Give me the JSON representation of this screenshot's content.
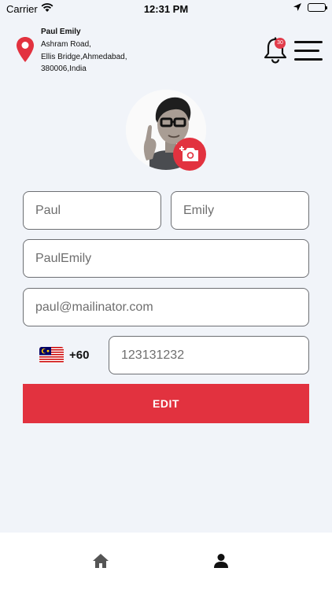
{
  "status_bar": {
    "carrier": "Carrier",
    "time": "12:31 PM"
  },
  "header": {
    "user_name": "Paul Emily",
    "address_lines": [
      "Ashram Road,",
      "Ellis Bridge,Ahmedabad,",
      "380006,India"
    ],
    "notification_count": "30",
    "icons": {
      "location": "location-pin-icon",
      "bell": "bell-icon",
      "menu": "hamburger-menu-icon"
    }
  },
  "profile": {
    "camera_icon": "camera-add-icon"
  },
  "form": {
    "first_name": "Paul",
    "last_name": "Emily",
    "username": "PaulEmily",
    "email": "paul@mailinator.com",
    "country_code": "+60",
    "phone": "123131232",
    "edit_label": "EDIT"
  },
  "tabbar": {
    "items": [
      {
        "icon": "home-icon"
      },
      {
        "icon": "profile-icon"
      }
    ]
  },
  "colors": {
    "accent": "#e2323f",
    "background": "#f1f4f9"
  }
}
